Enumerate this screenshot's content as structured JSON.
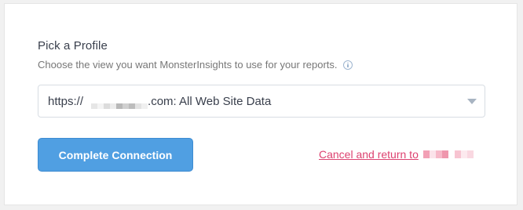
{
  "profile": {
    "title": "Pick a Profile",
    "subtitle": "Choose the view you want MonsterInsights to use for your reports.",
    "info_icon": "info-icon"
  },
  "select": {
    "prefix": "https://",
    "suffix": ".com: All Web Site Data",
    "chevron_icon": "chevron-down-icon"
  },
  "actions": {
    "complete_label": "Complete Connection",
    "cancel_label": "Cancel and return to"
  },
  "colors": {
    "accent_button": "#509fe2",
    "cancel_link": "#dd4270"
  }
}
